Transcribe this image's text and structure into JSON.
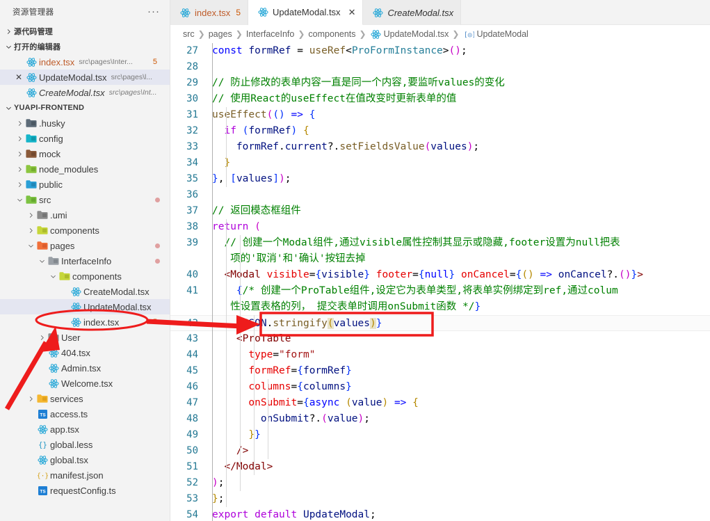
{
  "sidebar": {
    "title": "资源管理器",
    "more_label": "···",
    "sections": [
      {
        "label": "源代码管理",
        "expanded": false
      },
      {
        "label": "打开的编辑器",
        "expanded": true
      },
      {
        "label": "YUAPI-FRONTEND",
        "expanded": true
      }
    ],
    "open_editors": [
      {
        "name": "index.tsx",
        "desc": "src\\pages\\Inter...",
        "badge": "5",
        "icon": "react-icon",
        "closeable": false,
        "selected": false,
        "italic": false,
        "modified": true
      },
      {
        "name": "UpdateModal.tsx",
        "desc": "src\\pages\\l...",
        "badge": "",
        "icon": "react-icon",
        "closeable": true,
        "selected": true,
        "italic": false,
        "modified": false
      },
      {
        "name": "CreateModal.tsx",
        "desc": "src\\pages\\Int...",
        "badge": "",
        "icon": "react-icon",
        "closeable": false,
        "selected": false,
        "italic": true,
        "modified": false
      }
    ],
    "tree": [
      {
        "label": ".husky",
        "indent": 1,
        "type": "folder",
        "icon": "folder-husky-icon",
        "twisty": "right",
        "dot": false,
        "badge": ""
      },
      {
        "label": "config",
        "indent": 1,
        "type": "folder",
        "icon": "folder-config-icon",
        "twisty": "right",
        "dot": false,
        "badge": ""
      },
      {
        "label": "mock",
        "indent": 1,
        "type": "folder",
        "icon": "folder-mock-icon",
        "twisty": "right",
        "dot": false,
        "badge": ""
      },
      {
        "label": "node_modules",
        "indent": 1,
        "type": "folder",
        "icon": "folder-node-icon",
        "twisty": "right",
        "dot": false,
        "badge": ""
      },
      {
        "label": "public",
        "indent": 1,
        "type": "folder",
        "icon": "folder-public-icon",
        "twisty": "right",
        "dot": false,
        "badge": ""
      },
      {
        "label": "src",
        "indent": 1,
        "type": "folder",
        "icon": "folder-src-icon",
        "twisty": "down",
        "dot": true,
        "badge": ""
      },
      {
        "label": ".umi",
        "indent": 2,
        "type": "folder",
        "icon": "folder-plain-icon",
        "twisty": "right",
        "dot": false,
        "badge": ""
      },
      {
        "label": "components",
        "indent": 2,
        "type": "folder",
        "icon": "folder-comp-icon",
        "twisty": "right",
        "dot": false,
        "badge": ""
      },
      {
        "label": "pages",
        "indent": 2,
        "type": "folder",
        "icon": "folder-pages-icon",
        "twisty": "down",
        "dot": true,
        "badge": ""
      },
      {
        "label": "InterfaceInfo",
        "indent": 3,
        "type": "folder",
        "icon": "folder-plain2-icon",
        "twisty": "down",
        "dot": true,
        "badge": ""
      },
      {
        "label": "components",
        "indent": 4,
        "type": "folder",
        "icon": "folder-comp-icon",
        "twisty": "down",
        "dot": false,
        "badge": ""
      },
      {
        "label": "CreateModal.tsx",
        "indent": 5,
        "type": "file",
        "icon": "react-icon",
        "twisty": "none",
        "dot": false,
        "badge": ""
      },
      {
        "label": "UpdateModal.tsx",
        "indent": 5,
        "type": "file",
        "icon": "react-icon",
        "twisty": "none",
        "dot": false,
        "badge": "",
        "selected": true
      },
      {
        "label": "index.tsx",
        "indent": 5,
        "type": "file",
        "icon": "react-icon",
        "twisty": "none",
        "dot": false,
        "badge": "5"
      },
      {
        "label": "User",
        "indent": 3,
        "type": "folder",
        "icon": "folder-plain-icon",
        "twisty": "right",
        "dot": false,
        "badge": ""
      },
      {
        "label": "404.tsx",
        "indent": 3,
        "type": "file",
        "icon": "react-icon",
        "twisty": "none",
        "dot": false,
        "badge": ""
      },
      {
        "label": "Admin.tsx",
        "indent": 3,
        "type": "file",
        "icon": "react-icon",
        "twisty": "none",
        "dot": false,
        "badge": ""
      },
      {
        "label": "Welcome.tsx",
        "indent": 3,
        "type": "file",
        "icon": "react-icon",
        "twisty": "none",
        "dot": false,
        "badge": ""
      },
      {
        "label": "services",
        "indent": 2,
        "type": "folder",
        "icon": "folder-services-icon",
        "twisty": "right",
        "dot": false,
        "badge": ""
      },
      {
        "label": "access.ts",
        "indent": 2,
        "type": "file",
        "icon": "ts-icon",
        "twisty": "none",
        "dot": false,
        "badge": ""
      },
      {
        "label": "app.tsx",
        "indent": 2,
        "type": "file",
        "icon": "react-icon",
        "twisty": "none",
        "dot": false,
        "badge": ""
      },
      {
        "label": "global.less",
        "indent": 2,
        "type": "file",
        "icon": "less-icon",
        "twisty": "none",
        "dot": false,
        "badge": ""
      },
      {
        "label": "global.tsx",
        "indent": 2,
        "type": "file",
        "icon": "react-icon",
        "twisty": "none",
        "dot": false,
        "badge": ""
      },
      {
        "label": "manifest.json",
        "indent": 2,
        "type": "file",
        "icon": "json-icon",
        "twisty": "none",
        "dot": false,
        "badge": ""
      },
      {
        "label": "requestConfig.ts",
        "indent": 2,
        "type": "file",
        "icon": "ts-icon",
        "twisty": "none",
        "dot": false,
        "badge": ""
      }
    ]
  },
  "tabs": [
    {
      "label": "index.tsx",
      "icon": "react-icon",
      "active": false,
      "closeable": false,
      "badge": "5",
      "italic": false,
      "modified": true
    },
    {
      "label": "UpdateModal.tsx",
      "icon": "react-icon",
      "active": true,
      "closeable": true,
      "badge": "",
      "italic": false,
      "modified": false
    },
    {
      "label": "CreateModal.tsx",
      "icon": "react-icon",
      "active": false,
      "closeable": false,
      "badge": "",
      "italic": true,
      "modified": false
    }
  ],
  "breadcrumb": [
    {
      "label": "src",
      "icon": ""
    },
    {
      "label": "pages",
      "icon": ""
    },
    {
      "label": "InterfaceInfo",
      "icon": ""
    },
    {
      "label": "components",
      "icon": ""
    },
    {
      "label": "UpdateModal.tsx",
      "icon": "react-icon"
    },
    {
      "label": "UpdateModal",
      "icon": "symbol-variable-icon"
    }
  ],
  "editor": {
    "first_line": 27,
    "current_line": 42,
    "lines": [
      {
        "no": "27",
        "text": "const formRef = useRef<ProFormInstance>();"
      },
      {
        "no": "28",
        "text": ""
      },
      {
        "no": "29",
        "text": "// 防止修改的表单内容一直是同一个内容,要监听values的变化"
      },
      {
        "no": "30",
        "text": "// 使用React的useEffect在值改变时更新表单的值"
      },
      {
        "no": "31",
        "text": "useEffect(() => {"
      },
      {
        "no": "32",
        "text": "  if (formRef) {"
      },
      {
        "no": "33",
        "text": "    formRef.current?.setFieldsValue(values);"
      },
      {
        "no": "34",
        "text": "  }"
      },
      {
        "no": "35",
        "text": "}, [values]);"
      },
      {
        "no": "36",
        "text": ""
      },
      {
        "no": "37",
        "text": "// 返回模态框组件"
      },
      {
        "no": "38",
        "text": "return ("
      },
      {
        "no": "39",
        "text": "  // 创建一个Modal组件,通过visible属性控制其显示或隐藏,footer设置为null把表项的'取消'和'确认'按钮去掉"
      },
      {
        "no": "40",
        "text": "  <Modal visible={visible} footer={null} onCancel={() => onCancel?.()}>"
      },
      {
        "no": "41",
        "text": "    {/* 创建一个ProTable组件,设定它为表单类型,将表单实例绑定到ref,通过columns属性设置表格的列， 提交表单时调用onSubmit函数 */}"
      },
      {
        "no": "42",
        "text": "    {JSON.stringify(values)}"
      },
      {
        "no": "43",
        "text": "    <ProTable"
      },
      {
        "no": "44",
        "text": "      type=\"form\""
      },
      {
        "no": "45",
        "text": "      formRef={formRef}"
      },
      {
        "no": "46",
        "text": "      columns={columns}"
      },
      {
        "no": "47",
        "text": "      onSubmit={async (value) => {"
      },
      {
        "no": "48",
        "text": "        onSubmit?.(value);"
      },
      {
        "no": "49",
        "text": "      }}"
      },
      {
        "no": "50",
        "text": "    />"
      },
      {
        "no": "51",
        "text": "  </Modal>"
      },
      {
        "no": "52",
        "text": ");"
      },
      {
        "no": "53",
        "text": "};"
      },
      {
        "no": "54",
        "text": "export default UpdateModal;"
      }
    ]
  },
  "annotations": {
    "color": "#ee1c1c",
    "ellipse_target": "UpdateModal.tsx",
    "rect_target": "{JSON.stringify(values)}",
    "arrow_from_tree_label": "UpdateModal.tsx",
    "arrow_to_line": "42"
  }
}
